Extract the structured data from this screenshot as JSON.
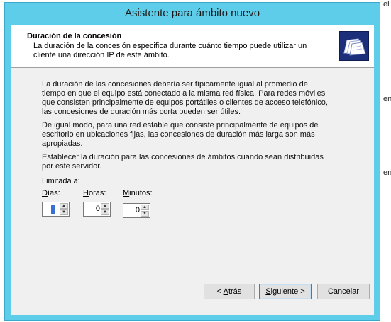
{
  "window": {
    "title": "Asistente para ámbito nuevo"
  },
  "header": {
    "title": "Duración de la concesión",
    "subtitle": "La duración de la concesión especifica durante cuánto tiempo puede utilizar un cliente una dirección IP de este ámbito.",
    "icon": "folder-wizard-icon"
  },
  "body": {
    "paragraph1": "La duración de las concesiones debería ser típicamente igual al promedio de tiempo en que el equipo está conectado a la misma red física. Para redes móviles que consisten principalmente de equipos portátiles o clientes de acceso telefónico, las concesiones de duración más corta pueden ser útiles.",
    "paragraph2": "De igual modo, para una red estable que consiste principalmente de equipos de escritorio en ubicaciones fijas, las concesiones de duración más larga son más apropiadas.",
    "paragraph3": "Establecer la duración para las concesiones de ámbitos cuando sean distribuidas por este servidor.",
    "limited_label": "Limitada a:"
  },
  "duration": {
    "days": {
      "label_pre": "D",
      "label_rest": "ías:",
      "value": "8"
    },
    "hours": {
      "label_pre": "H",
      "label_rest": "oras:",
      "value": "0"
    },
    "minutes": {
      "label_pre": "M",
      "label_rest": "inutos:",
      "value": "0"
    }
  },
  "buttons": {
    "back": {
      "pre": "< ",
      "u": "A",
      "rest": "trás"
    },
    "next": {
      "pre": "",
      "u": "S",
      "rest": "iguiente >"
    },
    "cancel": "Cancelar"
  },
  "background": {
    "fragment1": "en",
    "fragment2": "en",
    "fragment3": "el"
  }
}
